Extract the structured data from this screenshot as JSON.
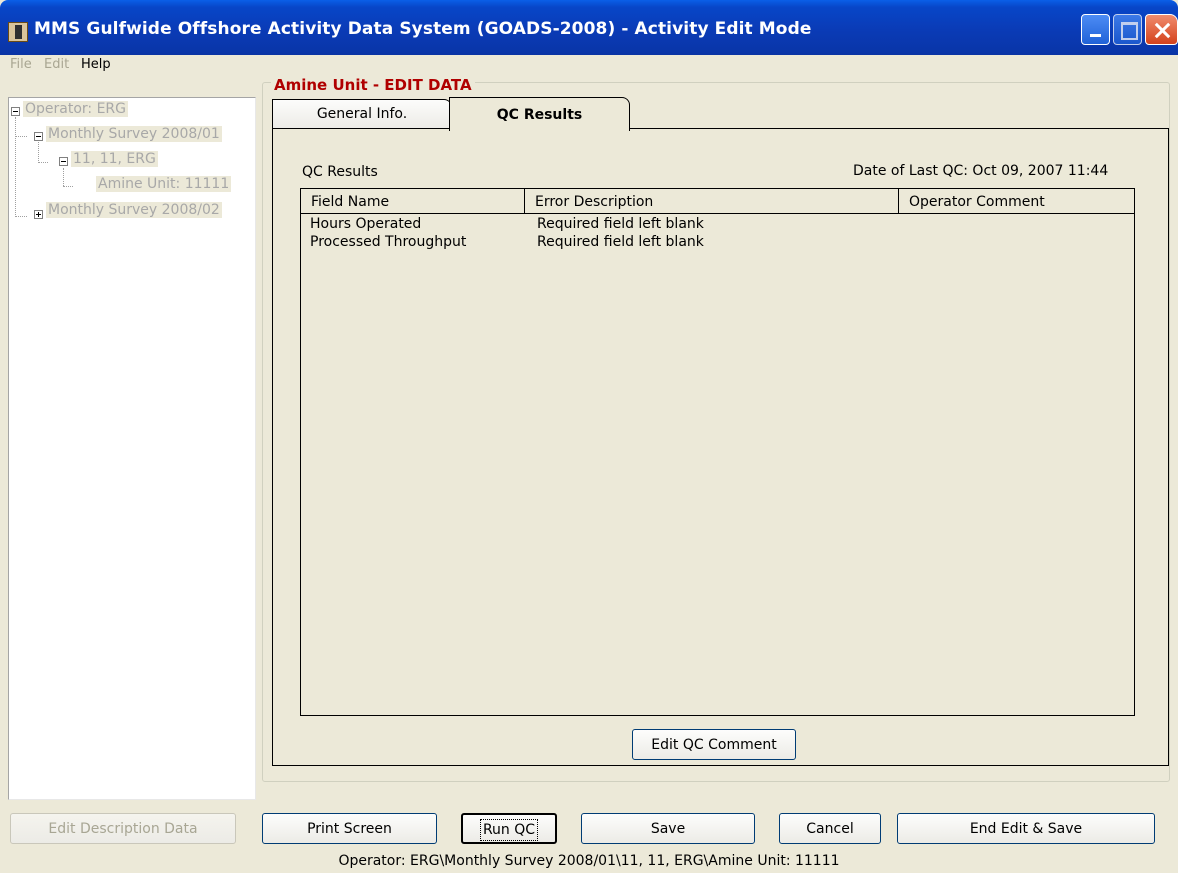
{
  "window": {
    "title": "MMS Gulfwide Offshore Activity Data System (GOADS-2008) - Activity Edit Mode"
  },
  "menu": {
    "items": [
      {
        "label": "File",
        "enabled": false
      },
      {
        "label": "Edit",
        "enabled": false
      },
      {
        "label": "Help",
        "enabled": true
      }
    ]
  },
  "tree": {
    "nodes": [
      {
        "label": "Operator: ERG",
        "expanded": true
      },
      {
        "label": "Monthly Survey 2008/01",
        "expanded": true
      },
      {
        "label": "11, 11, ERG",
        "expanded": true
      },
      {
        "label": "Amine Unit: 11111"
      },
      {
        "label": "Monthly Survey 2008/02",
        "expanded": false
      }
    ]
  },
  "editor": {
    "group_title": "Amine Unit - EDIT DATA",
    "tabs": [
      {
        "label": "General Info.",
        "active": false
      },
      {
        "label": "QC Results",
        "active": true
      }
    ],
    "qc_label": "QC Results",
    "last_qc": "Date of Last QC: Oct 09, 2007 11:44",
    "grid": {
      "columns": [
        "Field Name",
        "Error Description",
        "Operator Comment"
      ],
      "rows": [
        [
          "Hours Operated",
          "Required field left blank",
          ""
        ],
        [
          "Processed Throughput",
          "Required field left blank",
          ""
        ]
      ]
    },
    "edit_comment_button": "Edit QC Comment"
  },
  "buttons": {
    "edit_description": "Edit Description Data",
    "print_screen": "Print Screen",
    "run_qc": "Run QC",
    "save": "Save",
    "cancel": "Cancel",
    "end_edit_save": "End Edit & Save"
  },
  "status": {
    "path": "Operator: ERG\\Monthly Survey 2008/01\\11, 11, ERG\\Amine Unit: 11111"
  },
  "colors": {
    "titlebar": "#0a3bb6",
    "group_title": "#b00000",
    "face": "#ece9d8"
  }
}
